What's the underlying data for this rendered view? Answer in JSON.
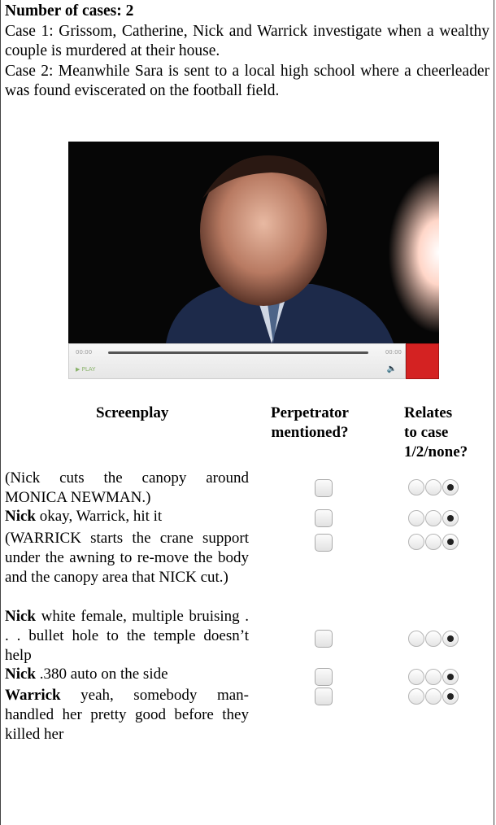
{
  "header": {
    "count_label": "Number of cases: 2",
    "case1": "Case 1: Grissom, Catherine, Nick and Warrick investigate when a wealthy couple is murdered at their house.",
    "case2": "Case 2: Meanwhile Sara is sent to a local high school where a cheerleader was found eviscerated on the football field."
  },
  "video": {
    "time_start": "00:00",
    "time_end": "00:00",
    "play_label": "PLAY",
    "progress": 0
  },
  "table": {
    "col_screenplay": "Screenplay",
    "col_perp": [
      "Perpetrator",
      "mentioned?"
    ],
    "col_case": [
      "Relates",
      "to case",
      "1/2/none?"
    ],
    "rows": [
      {
        "speaker": "",
        "text": "(Nick cuts the canopy around MONICA NEWMAN.)",
        "perp_checked": false,
        "case_choice": "none"
      },
      {
        "speaker": "Nick",
        "text": " okay, Warrick, hit it",
        "perp_checked": false,
        "case_choice": "none"
      },
      {
        "speaker": "",
        "text": "(WARRICK starts the crane support under the awning to re-move the body and the canopy area that NICK cut.)",
        "perp_checked": false,
        "case_choice": "none"
      },
      {
        "speaker": "Nick",
        "text": " white female, multiple bruising . . . bullet hole to the temple doesn’t help",
        "perp_checked": false,
        "case_choice": "none"
      },
      {
        "speaker": "Nick",
        "text": " .380 auto on the side",
        "perp_checked": false,
        "case_choice": "none"
      },
      {
        "speaker": "Warrick",
        "text": " yeah, somebody man-handled her pretty good before they killed her",
        "perp_checked": false,
        "case_choice": "none"
      }
    ]
  }
}
